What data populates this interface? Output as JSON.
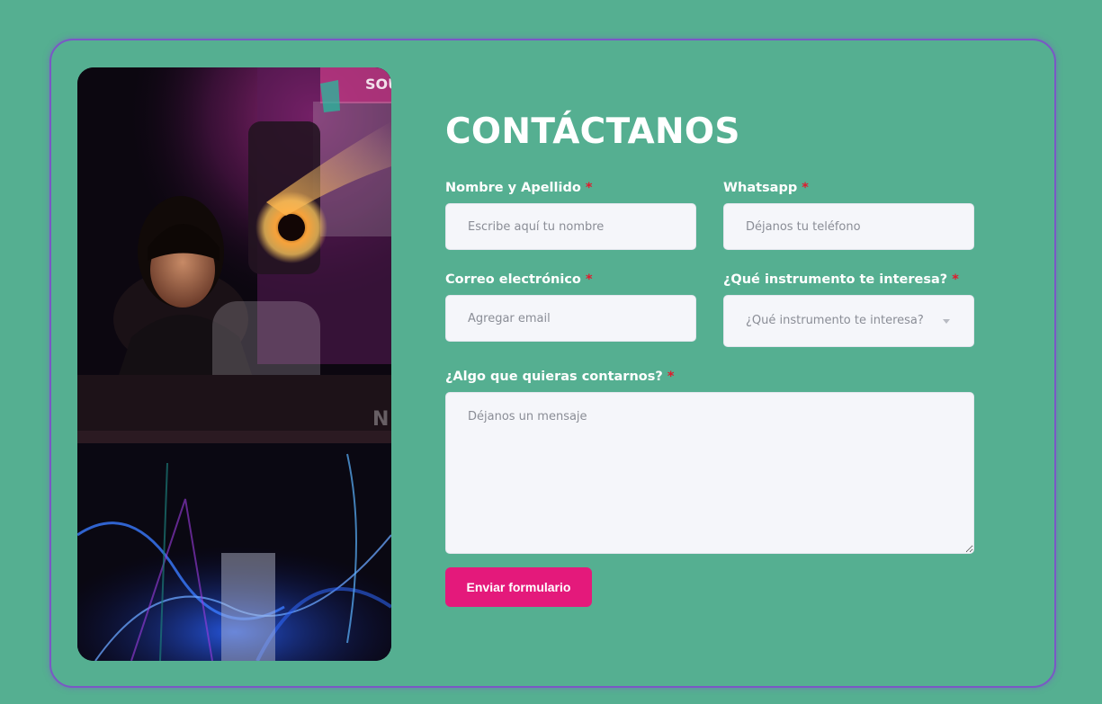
{
  "form": {
    "title": "CONTÁCTANOS",
    "required_mark": "*",
    "name": {
      "label": "Nombre y Apellido",
      "placeholder": "Escribe aquí tu nombre",
      "value": ""
    },
    "whatsapp": {
      "label": "Whatsapp",
      "placeholder": "Déjanos tu teléfono",
      "value": ""
    },
    "email": {
      "label": "Correo electrónico",
      "placeholder": "Agregar email",
      "value": ""
    },
    "instrument": {
      "label": "¿Qué instrumento te interesa?",
      "selected": "¿Qué instrumento te interesa?"
    },
    "message": {
      "label": "¿Algo que quieras contarnos?",
      "placeholder": "Déjanos un mensaje",
      "value": ""
    },
    "submit_label": "Enviar formulario"
  },
  "photo": {
    "logo_text": "SOU",
    "keyboard_brand_text": "N"
  },
  "colors": {
    "background": "#55af91",
    "card_border": "#7a58c5",
    "input_background": "#f5f6fa",
    "required_star": "#e3192c",
    "submit_button": "#e4197b"
  }
}
